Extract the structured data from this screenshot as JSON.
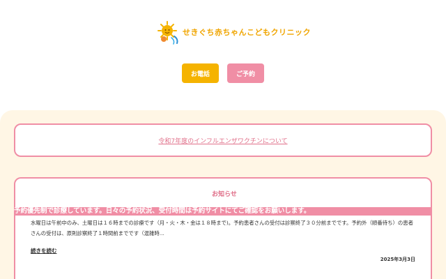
{
  "header": {
    "logo_text": "せきぐち赤ちゃんこどもクリニック",
    "phone_button": "お電話",
    "reserve_button": "ご予約"
  },
  "flu_notice": {
    "link_text": "令和7年度のインフルエンザワクチンについて"
  },
  "news": {
    "title": "お知らせ",
    "banner": "予約優先制で診療しています。日々の予約状況、受付時間は予約サイトにてご確認をお願いします。",
    "body": "水曜日は午前中のみ、土曜日は１６時までの診療です（月・火・木・金は１８時まで)。予約患者さんの受付は診察終了３０分前までです。予約外（順番待ち）の患者さんの受付は、原則診察終了１時間前までです（混雑時...",
    "read_more": "続きを読む",
    "date": "2025年3月3日"
  },
  "colors": {
    "accent_pink": "#f08ea5",
    "accent_yellow": "#f5b300",
    "cream_bg": "#fff6e5"
  }
}
